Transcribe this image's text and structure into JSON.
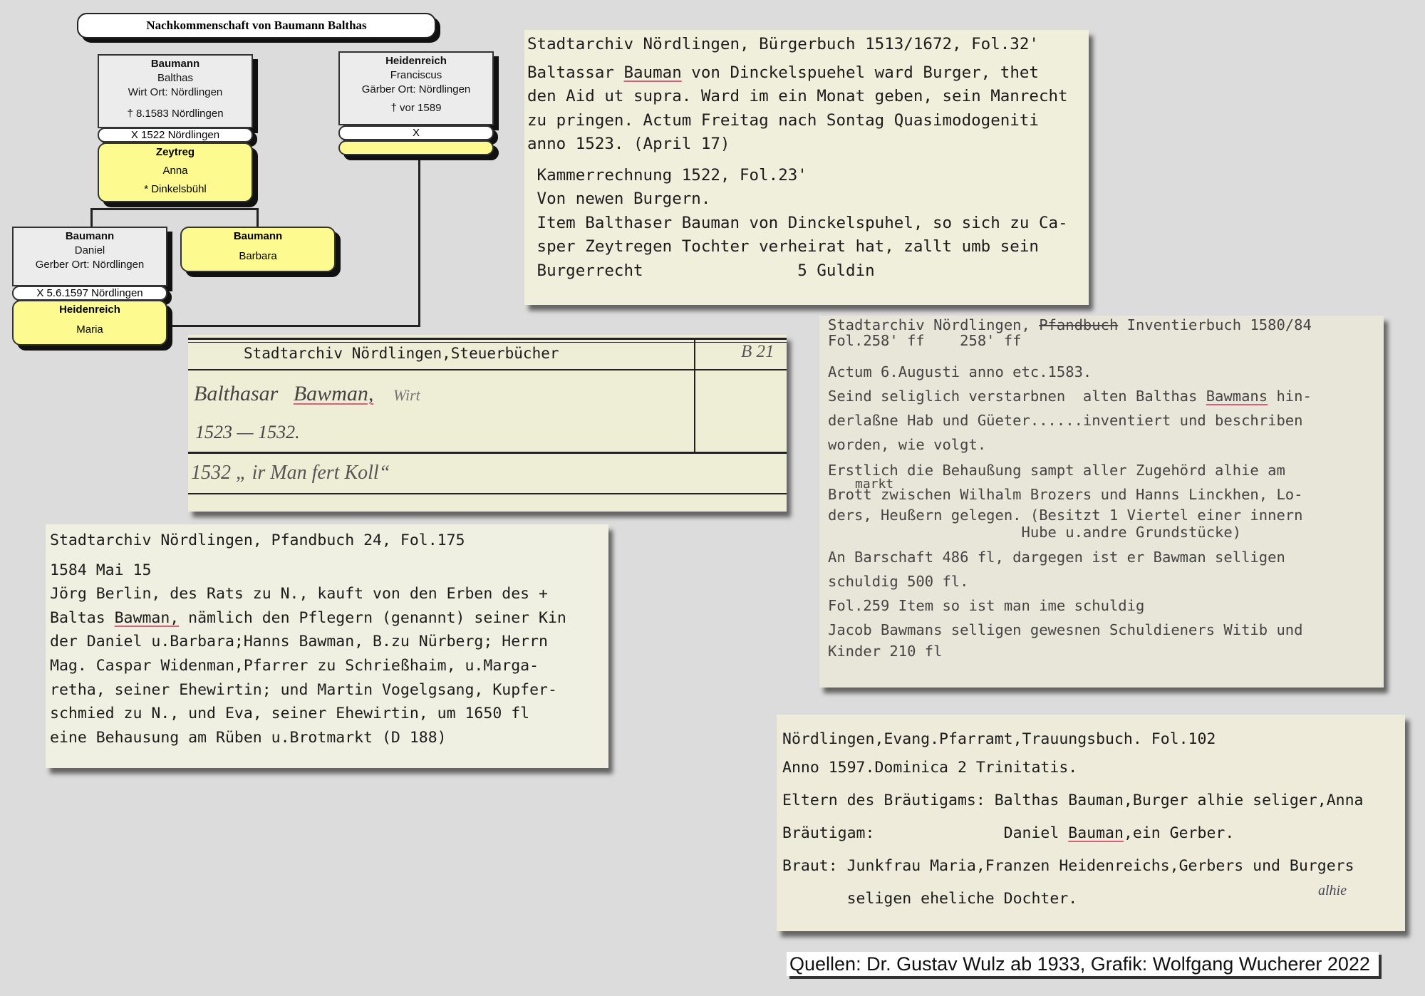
{
  "tree": {
    "title": "Nachkommenschaft von Baumann Balthas",
    "balthas": {
      "surname": "Baumann",
      "given": "Balthas",
      "occ": "Wirt Ort: Nördlingen",
      "death": "† 8.1583 Nördlingen"
    },
    "marriage1": "X 1522 Nördlingen",
    "anna": {
      "surname": "Zeytreg",
      "given": "Anna",
      "birth": "*  Dinkelsbühl"
    },
    "franciscus": {
      "surname": "Heidenreich",
      "given": "Franciscus",
      "occ": "Gärber Ort: Nördlingen",
      "death": "† vor 1589"
    },
    "marriage2": "X",
    "daniel": {
      "surname": "Baumann",
      "given": "Daniel",
      "occ": "Gerber Ort: Nördlingen"
    },
    "marriage3": "X 5.6.1597 Nördlingen",
    "maria": {
      "surname": "Heidenreich",
      "given": "Maria"
    },
    "barbara": {
      "surname": "Baumann",
      "given": "Barbara"
    }
  },
  "card1": {
    "lines": [
      "Stadtarchiv Nördlingen, Bürgerbuch 1513/1672, Fol.32'",
      "Baltassar ",
      "den Aid ut supra. Ward im ein Monat geben, sein Manrecht",
      "zu pringen. Actum Freitag nach Sontag Quasimodogeniti",
      "anno 1523. (April 17)",
      " Kammerrechnung 1522, Fol.23'",
      " Von newen Burgern.",
      " Item Balthaser Bauman von Dinckelspuhel, so sich zu Ca-",
      " sper Zeytregen Tochter verheirat hat, zallt umb sein",
      " Burgerrecht                5 Guldin"
    ],
    "name_u": "Bauman",
    "line2_rest": " von Dinckelspuehel ward Burger, thet"
  },
  "card2": {
    "header": "Stadtarchiv Nördlingen,Steuerbücher",
    "tag": "B 21",
    "hand1a": "Balthasar",
    "hand1b": "Bawman,",
    "hand1c": "Wirt",
    "hand2": "1523 — 1532.",
    "hand3": "1532 „ ir Man fert Koll“"
  },
  "card3": {
    "lines": [
      "Stadtarchiv Nördlingen, Pfandbuch 24, Fol.175",
      "1584 Mai 15",
      "Jörg Berlin, des Rats zu N., kauft von den Erben des +",
      "Baltas ",
      "der Daniel u.Barbara;Hanns Bawman, B.zu Nürberg; Herrn",
      "Mag. Caspar Widenman,Pfarrer zu Schrießhaim, u.Marga-",
      "retha, seiner Ehewirtin; und Martin Vogelgsang, Kupfer-",
      "schmied zu N., und Eva, seiner Ehewirtin, um 1650 fl",
      "eine Behausung am Rüben u.Brotmarkt (D 188)"
    ],
    "name_u": "Bawman,",
    "line4_rest": " nämlich den Pflegern (genannt) seiner Kin"
  },
  "card4": {
    "line1a": "Stadtarchiv Nördlingen, ",
    "line1strike": "Pfandbuch",
    "line1b": " Inventierbuch 1580/84",
    "line2": "Fol.258' ff    258' ff",
    "lines": [
      "Actum 6.Augusti anno etc.1583.",
      "Seind seliglich verstarbnen  alten Balthas ",
      "derlaßne Hab und Güeter......inventiert und beschriben",
      "worden, wie volgt.",
      "Erstlich die Behaußung sampt aller Zugehörd alhie am",
      "Brott zwischen Wilhalm Brozers und Hanns Linckhen, Lo-",
      "ders, Heußern gelegen. (Besitzt 1 Viertel einer innern",
      "                      Hube u.andre Grundstücke)",
      "An Barschaft 486 fl, dargegen ist er Bawman selligen",
      "schuldig 500 fl.",
      "Fol.259 Item so ist man ime schuldig",
      "Jacob Bawmans selligen gewesnen Schuldieners Witib und",
      "Kinder 210 fl"
    ],
    "name_u": "Bawmans",
    "line_rest": " hin-",
    "insert": "markt"
  },
  "card5": {
    "lines": [
      "Nördlingen,Evang.Pfarramt,Trauungsbuch. Fol.102",
      "Anno 1597.Dominica 2 Trinitatis.",
      "Eltern des Bräutigams: Balthas Bauman,Burger alhie seliger,Anna",
      "Bräutigam:              Daniel ",
      "Braut: Junkfrau Maria,Franzen Heidenreichs,Gerbers und Burgers",
      "       seligen eheliche Dochter."
    ],
    "name_u": "Bauman",
    "line4_rest": ",ein Gerber.",
    "note": "alhie"
  },
  "source": "Quellen: Dr. Gustav Wulz ab 1933, Grafik: Wolfgang Wucherer  2022"
}
